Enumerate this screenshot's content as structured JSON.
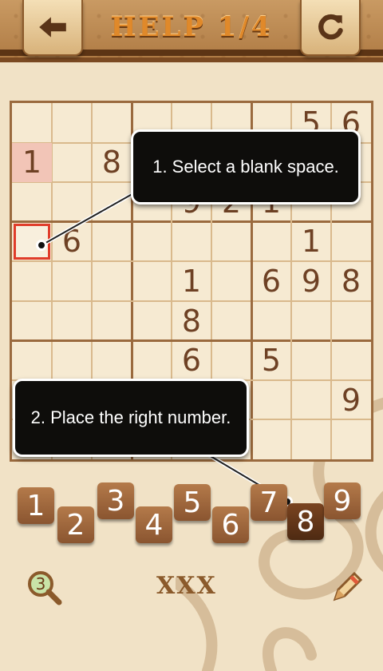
{
  "header": {
    "title": "HELP 1/4"
  },
  "board": {
    "cells": [
      {
        "r": 0,
        "c": 7,
        "v": "5"
      },
      {
        "r": 0,
        "c": 8,
        "v": "6"
      },
      {
        "r": 1,
        "c": 0,
        "v": "1"
      },
      {
        "r": 1,
        "c": 2,
        "v": "8"
      },
      {
        "r": 2,
        "c": 4,
        "v": "9"
      },
      {
        "r": 2,
        "c": 5,
        "v": "2"
      },
      {
        "r": 2,
        "c": 6,
        "v": "1"
      },
      {
        "r": 3,
        "c": 1,
        "v": "6"
      },
      {
        "r": 3,
        "c": 7,
        "v": "1"
      },
      {
        "r": 4,
        "c": 4,
        "v": "1"
      },
      {
        "r": 4,
        "c": 6,
        "v": "6"
      },
      {
        "r": 4,
        "c": 7,
        "v": "9"
      },
      {
        "r": 4,
        "c": 8,
        "v": "8"
      },
      {
        "r": 5,
        "c": 4,
        "v": "8"
      },
      {
        "r": 6,
        "c": 4,
        "v": "6"
      },
      {
        "r": 6,
        "c": 6,
        "v": "5"
      },
      {
        "r": 7,
        "c": 8,
        "v": "9"
      }
    ]
  },
  "callouts": {
    "step1": "1. Select a blank space.",
    "step2": "2. Place the right number."
  },
  "pad": {
    "numbers": [
      "1",
      "2",
      "3",
      "4",
      "5",
      "6",
      "7",
      "8",
      "9"
    ],
    "active": "8"
  },
  "footer": {
    "hint_count": "3",
    "mistakes": "XXX"
  }
}
